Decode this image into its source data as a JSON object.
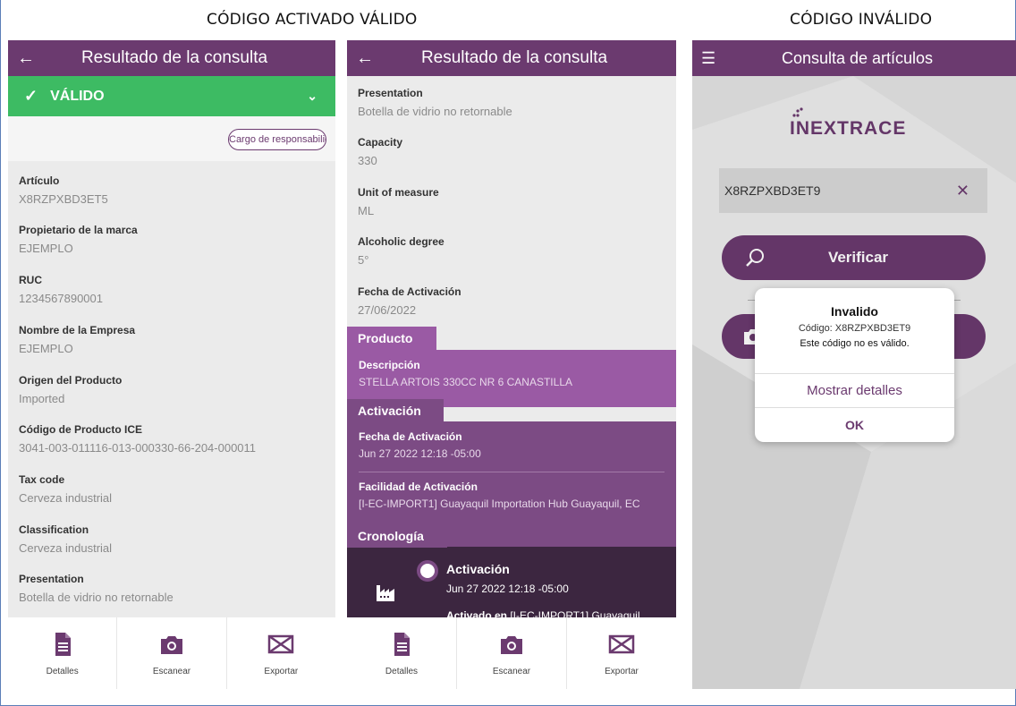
{
  "captions": {
    "valid": "CÓDIGO ACTIVADO VÁLIDO",
    "invalid": "CÓDIGO INVÁLIDO"
  },
  "colors": {
    "primary": "#6b3a6f",
    "success": "#3dbb63",
    "section": "#7c4b84"
  },
  "screen1": {
    "title": "Resultado de la consulta",
    "status": "VÁLIDO",
    "responsibility_button": "Cargo de responsabilidad",
    "fields": [
      {
        "label": "Artículo",
        "value": "X8RZPXBD3ET5"
      },
      {
        "label": "Propietario de la marca",
        "value": "EJEMPLO"
      },
      {
        "label": "RUC",
        "value": "1234567890001"
      },
      {
        "label": "Nombre de la Empresa",
        "value": "EJEMPLO"
      },
      {
        "label": "Origen del Producto",
        "value": "Imported"
      },
      {
        "label": "Código de Producto ICE",
        "value": "3041-003-011116-013-000330-66-204-000011"
      },
      {
        "label": "Tax code",
        "value": "Cerveza industrial"
      },
      {
        "label": "Classification",
        "value": "Cerveza industrial"
      },
      {
        "label": "Presentation",
        "value": "Botella de vidrio no retornable"
      }
    ]
  },
  "screen2": {
    "title": "Resultado de la consulta",
    "fields": [
      {
        "label": "Presentation",
        "value": "Botella de vidrio no retornable"
      },
      {
        "label": "Capacity",
        "value": "330"
      },
      {
        "label": "Unit of measure",
        "value": "ML"
      },
      {
        "label": "Alcoholic degree",
        "value": "5°"
      },
      {
        "label": "Fecha de Activación",
        "value": "27/06/2022"
      }
    ],
    "producto": {
      "tab": "Producto",
      "label": "Descripción",
      "value": "STELLA ARTOIS 330CC NR 6 CANASTILLA"
    },
    "activacion": {
      "tab": "Activación",
      "fecha_label": "Fecha de Activación",
      "fecha_value": "Jun 27 2022 12:18 -05:00",
      "facilidad_label": "Facilidad de Activación",
      "facilidad_value": "[I-EC-IMPORT1] Guayaquil Importation Hub Guayaquil, EC"
    },
    "cronologia": {
      "tab": "Cronología",
      "event_title": "Activación",
      "event_date": "Jun 27 2022 12:18 -05:00",
      "event_prefix": "Activado en",
      "event_place": " [I-EC-IMPORT1] Guayaquil"
    }
  },
  "screen3": {
    "title": "Consulta de artículos",
    "logo": "INEXTRACE",
    "code_value": "X8RZPXBD3ET9",
    "verify_label": "Verificar",
    "dialog": {
      "title": "Invalido",
      "code_line": "Código: X8RZPXBD3ET9",
      "message": "Este código no es válido.",
      "details": "Mostrar detalles",
      "ok": "OK"
    }
  },
  "nav": {
    "details": "Detalles",
    "scan": "Escanear",
    "export": "Exportar"
  }
}
